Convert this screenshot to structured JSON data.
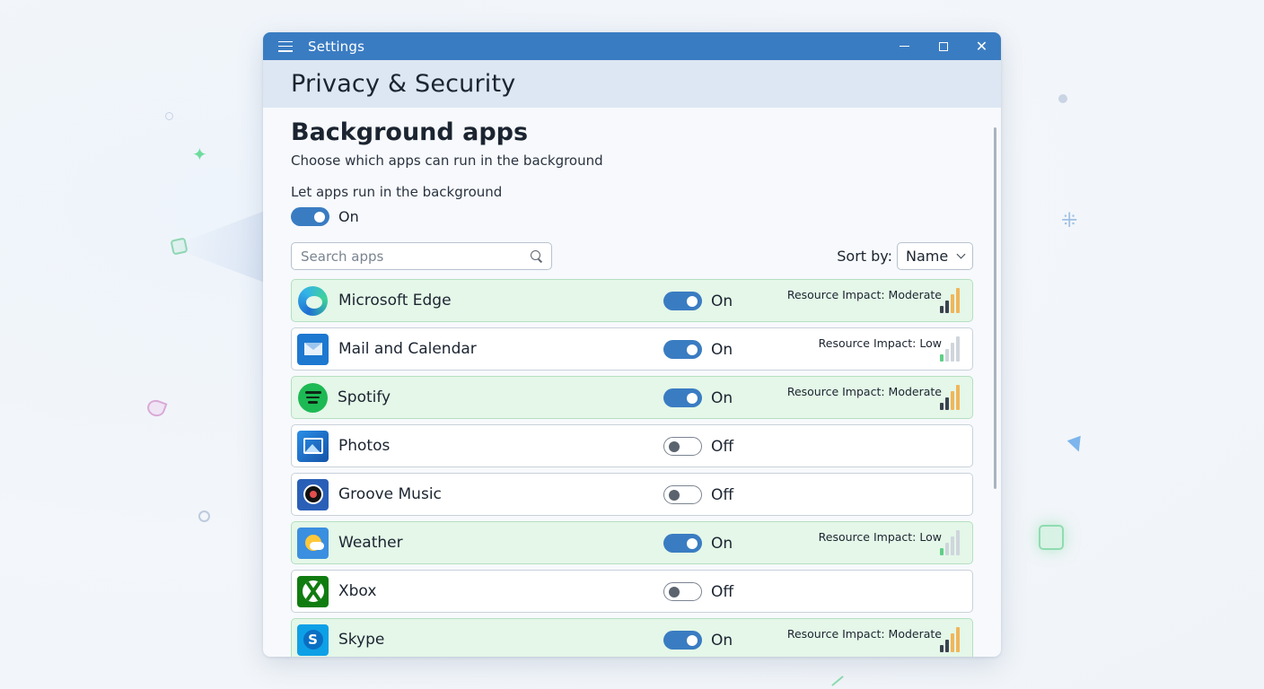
{
  "window": {
    "title": "Settings"
  },
  "header": {
    "page_title": "Privacy & Security"
  },
  "section": {
    "title": "Background apps",
    "subtitle": "Choose which apps can run in the background"
  },
  "master": {
    "label": "Let apps run in the background",
    "state": "On"
  },
  "search": {
    "placeholder": "Search apps",
    "value": ""
  },
  "sort": {
    "label": "Sort by:",
    "value": "Name"
  },
  "apps": [
    {
      "name": "Microsoft Edge",
      "state": "On",
      "impact": "Resource Impact: Moderate",
      "impact_level": 3,
      "icon": "edge-icon"
    },
    {
      "name": "Mail and Calendar",
      "state": "On",
      "impact": "Resource Impact: Low",
      "impact_level": 1,
      "icon": "mail-icon"
    },
    {
      "name": "Spotify",
      "state": "On",
      "impact": "Resource Impact: Moderate",
      "impact_level": 3,
      "icon": "spotify-icon"
    },
    {
      "name": "Photos",
      "state": "Off",
      "impact": "",
      "impact_level": 0,
      "icon": "photos-icon"
    },
    {
      "name": "Groove Music",
      "state": "Off",
      "impact": "",
      "impact_level": 0,
      "icon": "groove-music-icon"
    },
    {
      "name": "Weather",
      "state": "On",
      "impact": "Resource Impact: Low",
      "impact_level": 1,
      "icon": "weather-icon"
    },
    {
      "name": "Xbox",
      "state": "Off",
      "impact": "",
      "impact_level": 0,
      "icon": "xbox-icon"
    },
    {
      "name": "Skype",
      "state": "On",
      "impact": "Resource Impact: Moderate",
      "impact_level": 3,
      "icon": "skype-icon"
    }
  ],
  "colors": {
    "accent": "#3a7cc2",
    "active_row": "#e4f7e8",
    "impact_bar_dark": "#3b434e",
    "impact_bar_warm": "#f0b65a",
    "impact_bar_low": "#5fcf86",
    "impact_bar_empty": "#cfd5dc"
  }
}
